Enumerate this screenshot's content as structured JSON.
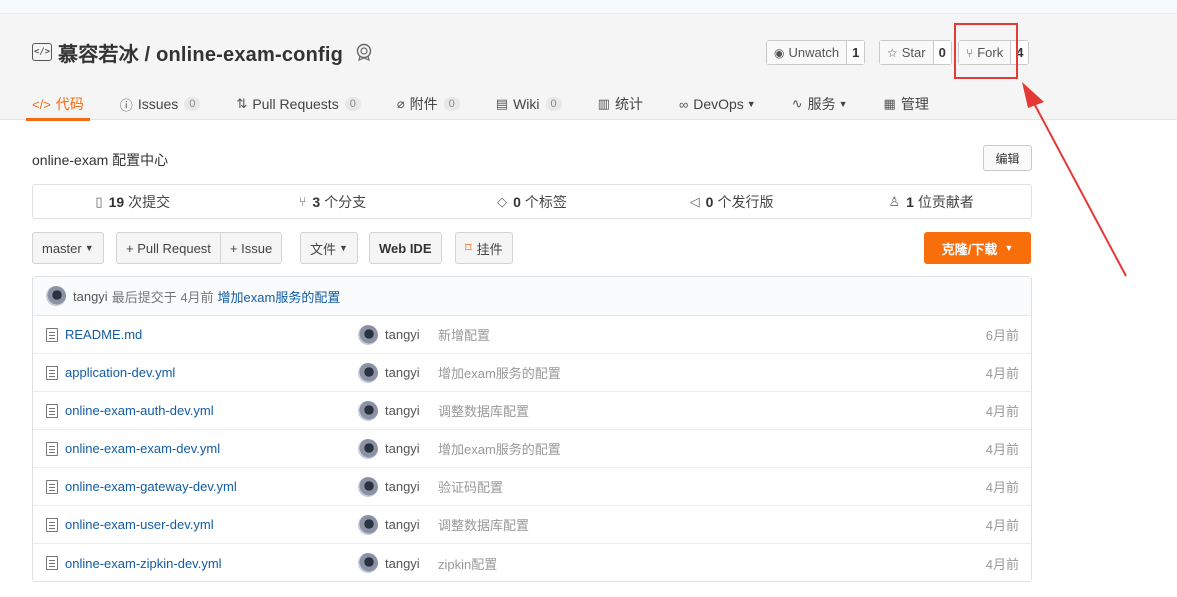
{
  "repo": {
    "title": "慕容若冰 / online-exam-config",
    "description": "online-exam 配置中心"
  },
  "actions": {
    "unwatch_label": "Unwatch",
    "unwatch_count": "1",
    "star_label": "Star",
    "star_count": "0",
    "fork_label": "Fork",
    "fork_count": "4"
  },
  "tabs": [
    {
      "label": "代码",
      "icon": "code-icon"
    },
    {
      "label": "Issues",
      "count": "0",
      "icon": "issue-icon"
    },
    {
      "label": "Pull Requests",
      "count": "0",
      "icon": "pull-request-icon"
    },
    {
      "label": "附件",
      "count": "0",
      "icon": "attachment-icon"
    },
    {
      "label": "Wiki",
      "count": "0",
      "icon": "wiki-icon"
    },
    {
      "label": "统计",
      "icon": "stats-icon"
    },
    {
      "label": "DevOps",
      "icon": "devops-icon"
    },
    {
      "label": "服务",
      "icon": "service-icon"
    },
    {
      "label": "管理",
      "icon": "manage-icon"
    }
  ],
  "edit_label": "编辑",
  "stats": [
    {
      "num": "19",
      "label": "次提交",
      "icon": "commit-icon"
    },
    {
      "num": "3",
      "label": "个分支",
      "icon": "branch-icon"
    },
    {
      "num": "0",
      "label": "个标签",
      "icon": "tag-icon"
    },
    {
      "num": "0",
      "label": "个发行版",
      "icon": "release-icon"
    },
    {
      "num": "1",
      "label": "位贡献者",
      "icon": "contributor-icon"
    }
  ],
  "toolbar": {
    "branch": "master",
    "pull_request": "+ Pull Request",
    "issue": "+ Issue",
    "file": "文件",
    "web_ide": "Web IDE",
    "widget": "挂件",
    "clone": "克隆/下载"
  },
  "last_commit": {
    "author": "tangyi",
    "meta": "最后提交于 4月前",
    "message": "增加exam服务的配置"
  },
  "files": [
    {
      "name": "README.md",
      "author": "tangyi",
      "message": "新增配置",
      "time": "6月前"
    },
    {
      "name": "application-dev.yml",
      "author": "tangyi",
      "message": "增加exam服务的配置",
      "time": "4月前"
    },
    {
      "name": "online-exam-auth-dev.yml",
      "author": "tangyi",
      "message": "调整数据库配置",
      "time": "4月前"
    },
    {
      "name": "online-exam-exam-dev.yml",
      "author": "tangyi",
      "message": "增加exam服务的配置",
      "time": "4月前"
    },
    {
      "name": "online-exam-gateway-dev.yml",
      "author": "tangyi",
      "message": "验证码配置",
      "time": "4月前"
    },
    {
      "name": "online-exam-user-dev.yml",
      "author": "tangyi",
      "message": "调整数据库配置",
      "time": "4月前"
    },
    {
      "name": "online-exam-zipkin-dev.yml",
      "author": "tangyi",
      "message": "zipkin配置",
      "time": "4月前"
    }
  ],
  "colors": {
    "accent": "#f66b0f",
    "link": "#135ca4",
    "annotation": "#e53935"
  }
}
